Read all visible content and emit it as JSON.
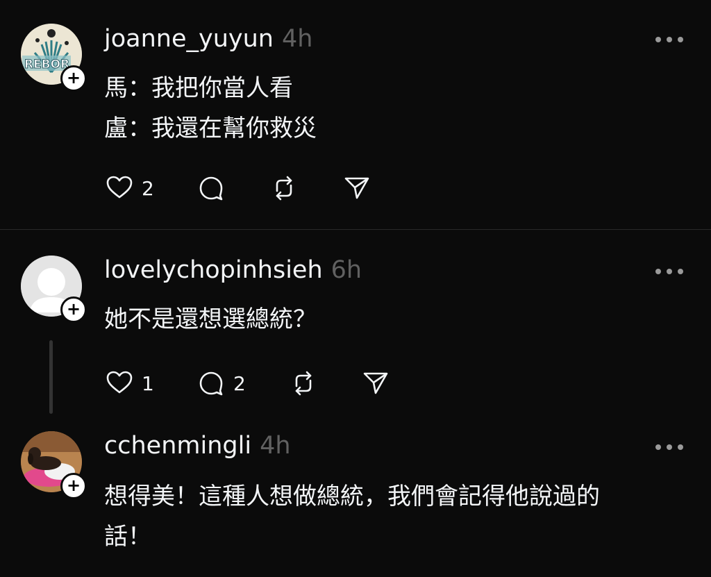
{
  "posts": [
    {
      "username": "joanne_yuyun",
      "time": "4h",
      "avatar_text": "REBOR",
      "lines": [
        "馬：我把你當人看",
        "盧：我還在幫你救災"
      ],
      "likes": "2",
      "comments": "",
      "icons": {
        "like": "heart-icon",
        "comment": "comment-icon",
        "repost": "repost-icon",
        "share": "send-icon",
        "more": "more-icon"
      }
    },
    {
      "username": "lovelychopinhsieh",
      "time": "6h",
      "lines": [
        "她不是還想選總統？"
      ],
      "likes": "1",
      "comments": "2"
    },
    {
      "username": "cchenmingli",
      "time": "4h",
      "lines": [
        "想得美！這種人想做總統，我們會記得他說過的",
        "話！"
      ]
    }
  ],
  "colors": {
    "background": "#0b0b0b",
    "text": "#f3f5f7",
    "muted": "#616161"
  }
}
